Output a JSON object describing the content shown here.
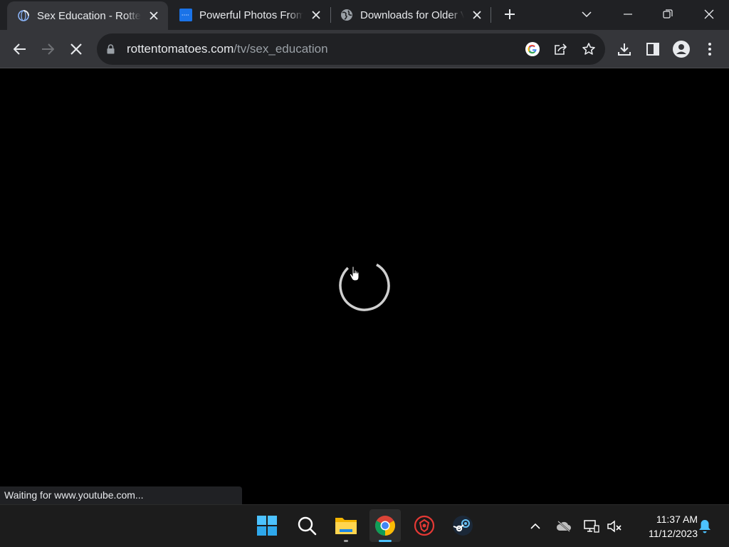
{
  "browser": {
    "tabs": [
      {
        "title": "Sex Education - Rotten Tomatoes",
        "favicon": "loading-globe-icon",
        "active": true
      },
      {
        "title": "Powerful Photos From the Past",
        "favicon": "blue-site-icon",
        "active": false
      },
      {
        "title": "Downloads for Older Versions",
        "favicon": "globe-icon",
        "active": false
      }
    ],
    "new_tab_label": "+",
    "address": {
      "domain": "rottentomatoes.com",
      "path": "/tv/sex_education"
    }
  },
  "content": {
    "status_text": "Waiting for www.youtube.com...",
    "state": "loading"
  },
  "taskbar": {
    "apps": [
      "windows-start-icon",
      "search-icon",
      "file-explorer-icon",
      "chrome-icon",
      "game-app-icon",
      "steam-icon"
    ],
    "clock": {
      "time": "11:37 AM",
      "date": "11/12/2023"
    }
  },
  "colors": {
    "tab_strip": "#202124",
    "toolbar": "#35363a",
    "page_bg": "#000000",
    "taskbar": "#1c1c1c",
    "accent_blue": "#4cc2ff"
  }
}
